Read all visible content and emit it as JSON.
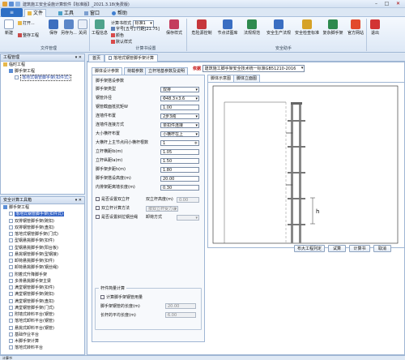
{
  "app": {
    "title": "建筑施工安全设施计算软件【标准版】_2021.3.18(免费版)",
    "menu_button": "≡",
    "tabs": [
      {
        "label": "文件",
        "active": true
      },
      {
        "label": "工具",
        "active": false
      },
      {
        "label": "窗口",
        "active": false
      },
      {
        "label": "帮助",
        "active": false
      }
    ]
  },
  "ribbon": {
    "file_group": {
      "label": "文件管理",
      "new": "新建",
      "open": "打开...",
      "save_project": "整存工程",
      "save": "保存",
      "save_as": "另存为...",
      "close": "关闭"
    },
    "project_group": {
      "label": "计算书设置",
      "project_info": "工程信息",
      "calc_style_label": "计算书样式",
      "calc_style_value": "标准1",
      "font_label": "字号",
      "font_value": "五号",
      "line_spacing_label": "行距",
      "line_spacing_value": "21.75",
      "color_label": "颜色",
      "save_style": "保存样式",
      "default_style": "默认样式"
    },
    "safety_group": {
      "label": "安全助手",
      "items": [
        "危险源控制",
        "节点详图库",
        "法规规范",
        "安全生产法规",
        "安全检查标准",
        "复杂脚手架",
        "官方网站"
      ]
    },
    "exit": "退出"
  },
  "project_panel": {
    "title": "工程管理",
    "pin": "▾ ✕",
    "tree": [
      {
        "label": "临时工程",
        "level": 0
      },
      {
        "label": "脚手架工程",
        "level": 1
      },
      {
        "label": "落地式钢管脚手架(扣件式)",
        "level": 2,
        "selected": true
      }
    ]
  },
  "tools_panel": {
    "title": "安全计算工具箱",
    "pin": "▾ ✕",
    "tree": [
      {
        "label": "脚手架工程",
        "level": 0
      },
      {
        "label": "落地式钢管脚手架(扣件式)",
        "level": 1,
        "highlight": true
      },
      {
        "label": "双排钢管脚手架(碗扣)",
        "level": 1
      },
      {
        "label": "双排钢管脚手架(盘扣)",
        "level": 1
      },
      {
        "label": "落地式钢管脚手架(门式)",
        "level": 1
      },
      {
        "label": "型钢悬挑脚手架(扣件)",
        "level": 1
      },
      {
        "label": "型钢悬挑脚手架(阳台板)",
        "level": 1
      },
      {
        "label": "悬挑钢管脚手架(型钢接)",
        "level": 1
      },
      {
        "label": "卸荷悬挑脚手架(扣件)",
        "level": 1
      },
      {
        "label": "卸荷悬挑脚手架(钢丝绳)",
        "level": 1
      },
      {
        "label": "附着式升降脚手架",
        "level": 1
      },
      {
        "label": "多排悬挑脚手架主梁",
        "level": 1
      },
      {
        "label": "满堂钢管脚手架(扣件)",
        "level": 1
      },
      {
        "label": "满堂钢管脚手架(碗扣)",
        "level": 1
      },
      {
        "label": "满堂钢管脚手架(盘扣)",
        "level": 1
      },
      {
        "label": "满堂钢管脚手架(门式)",
        "level": 1
      },
      {
        "label": "附墙式转料平台(钢管)",
        "level": 1
      },
      {
        "label": "落地式卸料平台(钢管)",
        "level": 1
      },
      {
        "label": "悬挑式卸料平台(钢管)",
        "level": 1
      },
      {
        "label": "基础作业平台",
        "level": 1
      },
      {
        "label": "木脚手架计算",
        "level": 1
      },
      {
        "label": "落地式转料平台",
        "level": 1
      }
    ]
  },
  "status": {
    "left": "计算书"
  },
  "doc_tabs": [
    {
      "label": "首页",
      "active": false
    },
    {
      "label": "落地式钢管脚手架计算",
      "active": true
    }
  ],
  "headline": {
    "label": "依据",
    "value": "建筑施工脚手架安全技术统一标准GB51210-2016"
  },
  "param_tabs": [
    {
      "label": "脚体设计参数",
      "active": true
    },
    {
      "label": "荷载参数",
      "active": false
    },
    {
      "label": "立杆地基参数及说明",
      "active": false
    }
  ],
  "form": {
    "header": "脚手架搭设参数",
    "fields": [
      {
        "label": "脚手架类型",
        "value": "双排",
        "type": "dd"
      },
      {
        "label": "钢管外径",
        "value": "Φ48.3×3.6",
        "type": "dd"
      },
      {
        "label": "钢管截面抵抗矩W",
        "value": "1.00",
        "type": "text"
      },
      {
        "label": "连墙件布置",
        "value": "2步3跨",
        "type": "dd"
      },
      {
        "label": "连墙件连接方式",
        "value": "单扣件连接",
        "type": "dd"
      },
      {
        "label": "大小横杆布置",
        "value": "小横杆在上",
        "type": "dd"
      },
      {
        "label": "大横杆上主节点间小横杆根数",
        "value": "1",
        "type": "num"
      },
      {
        "label": "立杆横距lb(m)",
        "value": "1.05",
        "type": "text"
      },
      {
        "label": "立杆纵距la(m)",
        "value": "1.50",
        "type": "text"
      },
      {
        "label": "脚手架步距h(m)",
        "value": "1.80",
        "type": "text"
      },
      {
        "label": "脚手架搭设高度(m)",
        "value": "20.00",
        "type": "text"
      },
      {
        "label": "内排架距离墙长度(m)",
        "value": "0.30",
        "type": "text"
      }
    ],
    "check_rows": [
      {
        "label": "是否设置双立杆",
        "right_label": "双立杆高度(m)",
        "right_value": "0.00"
      },
      {
        "label": "双立杆计算方法",
        "right_label": "",
        "right_value": "按双立杆受力设"
      },
      {
        "label": "是否设置斜拉钢丝绳",
        "right_label": "卸荷方式",
        "right_value": ""
      }
    ],
    "group_title": "杆件简量计算",
    "group_check": "计算脚手架钢管用量",
    "group_rows": [
      {
        "label": "脚手架钢管的长度(m)",
        "value": "20.00"
      },
      {
        "label": "长杆的平均长度(m)",
        "value": "6.00"
      }
    ]
  },
  "view_tabs": [
    {
      "label": "脚体示意图",
      "active": true
    },
    {
      "label": "脚体立面图",
      "active": false
    }
  ],
  "diagram": {
    "h_label": "h"
  },
  "actions": [
    "布大工程列定",
    "试算",
    "计算书",
    "取消"
  ]
}
